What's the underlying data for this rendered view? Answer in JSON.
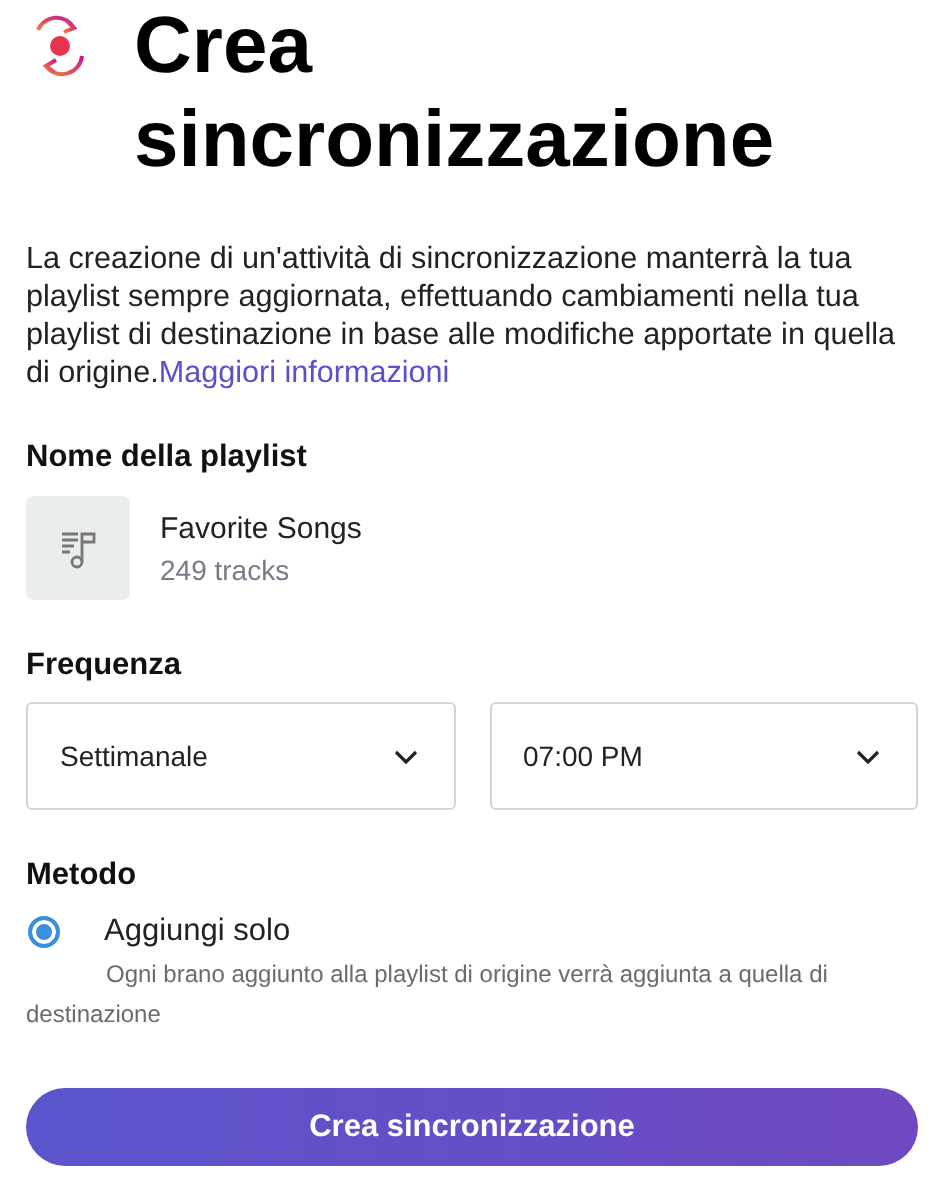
{
  "title": "Crea sincronizzazione",
  "description": {
    "text": "La creazione di un'attività di sincronizzazione manterrà la tua playlist sempre aggiornata, effettuando cambiamenti nella tua playlist di destinazione in base alle modifiche apportate in quella di origine.",
    "link": "Maggiori informazioni"
  },
  "playlist": {
    "label": "Nome della playlist",
    "name": "Favorite Songs",
    "count": "249 tracks"
  },
  "frequency": {
    "label": "Frequenza",
    "selects": [
      {
        "value": "Settimanale"
      },
      {
        "value": "07:00 PM"
      }
    ]
  },
  "method": {
    "label": "Metodo",
    "options": [
      {
        "label": "Aggiungi solo",
        "selected": true,
        "hint": "Ogni brano aggiunto alla playlist di origine verrà aggiunta a quella di destinazione"
      }
    ]
  },
  "submit": "Crea sincronizzazione"
}
